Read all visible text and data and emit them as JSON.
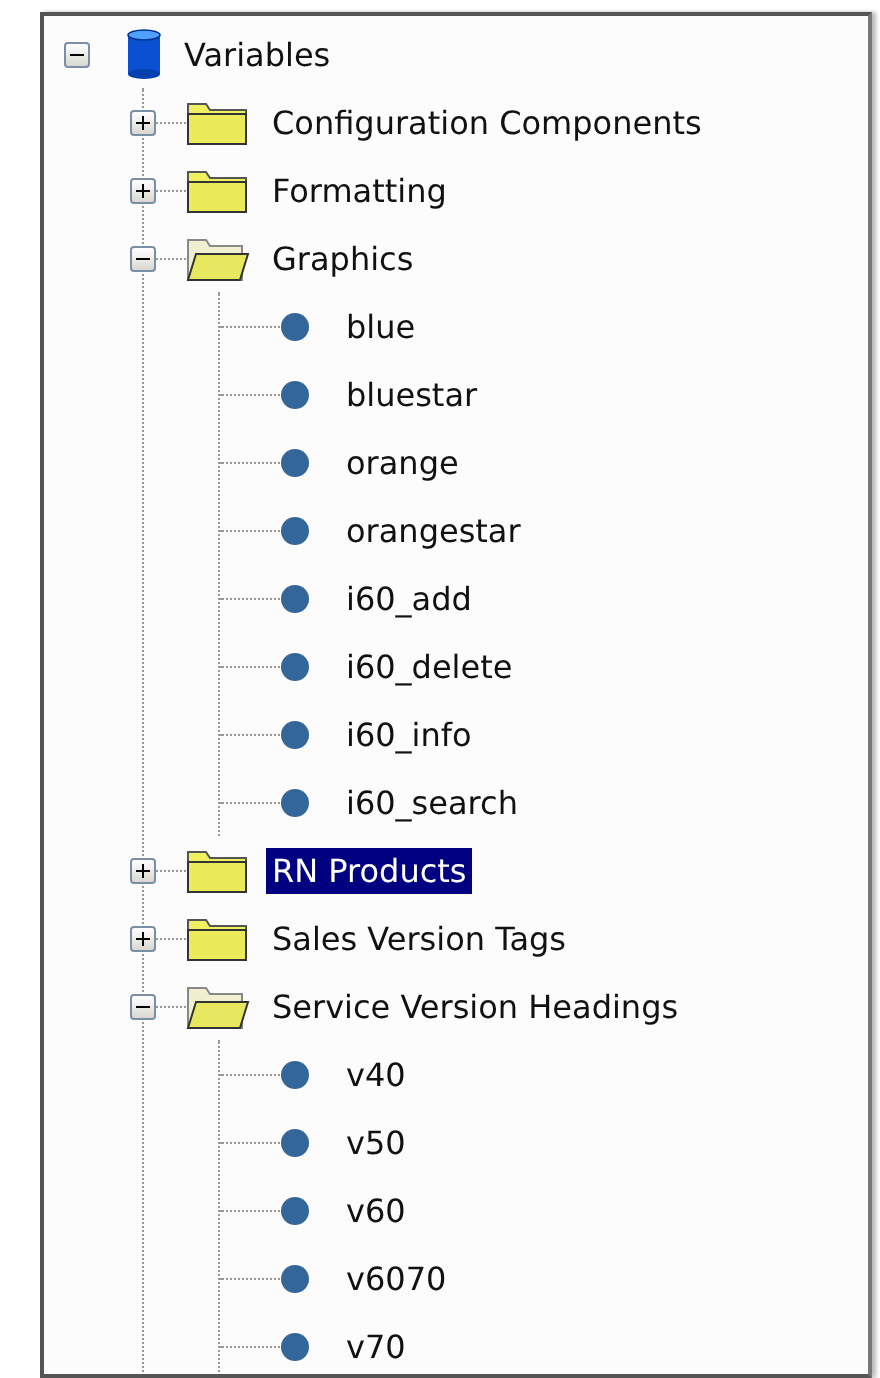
{
  "tree": {
    "label": "Variables",
    "kind": "database",
    "expanded": true,
    "selected": false,
    "children": [
      {
        "label": "Configuration Components",
        "kind": "folder",
        "expanded": false,
        "selected": false
      },
      {
        "label": "Formatting",
        "kind": "folder",
        "expanded": false,
        "selected": false
      },
      {
        "label": "Graphics",
        "kind": "folder",
        "expanded": true,
        "selected": false,
        "children": [
          {
            "label": "blue",
            "kind": "leaf",
            "selected": false
          },
          {
            "label": "bluestar",
            "kind": "leaf",
            "selected": false
          },
          {
            "label": "orange",
            "kind": "leaf",
            "selected": false
          },
          {
            "label": "orangestar",
            "kind": "leaf",
            "selected": false
          },
          {
            "label": "i60_add",
            "kind": "leaf",
            "selected": false
          },
          {
            "label": "i60_delete",
            "kind": "leaf",
            "selected": false
          },
          {
            "label": "i60_info",
            "kind": "leaf",
            "selected": false
          },
          {
            "label": "i60_search",
            "kind": "leaf",
            "selected": false
          }
        ]
      },
      {
        "label": "RN Products",
        "kind": "folder",
        "expanded": false,
        "selected": true
      },
      {
        "label": "Sales Version Tags",
        "kind": "folder",
        "expanded": false,
        "selected": false
      },
      {
        "label": "Service Version Headings",
        "kind": "folder",
        "expanded": true,
        "selected": false,
        "children": [
          {
            "label": "v40",
            "kind": "leaf",
            "selected": false
          },
          {
            "label": "v50",
            "kind": "leaf",
            "selected": false
          },
          {
            "label": "v60",
            "kind": "leaf",
            "selected": false
          },
          {
            "label": "v6070",
            "kind": "leaf",
            "selected": false
          },
          {
            "label": "v70",
            "kind": "leaf",
            "selected": false
          }
        ]
      }
    ]
  }
}
